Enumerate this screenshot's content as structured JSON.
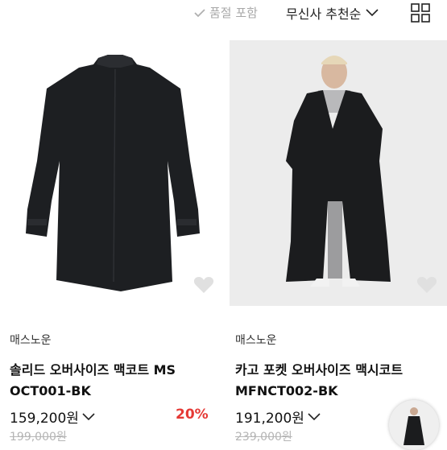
{
  "topbar": {
    "soldout_label": "품절 포함",
    "sort_label": "무신사 추천순"
  },
  "products": [
    {
      "brand": "매스노운",
      "name_line1": "솔리드 오버사이즈 맥코트 MS",
      "name_line2": "OCT001-BK",
      "price": "159,200원",
      "discount": "20%",
      "original_price": "199,000원"
    },
    {
      "brand": "매스노운",
      "name_line1": "카고 포켓 오버사이즈 맥시코트",
      "name_line2": "MFNCT002-BK",
      "price": "191,200원",
      "original_price": "239,000원"
    }
  ],
  "colors": {
    "discount": "#e53935",
    "muted": "#b5b5b5"
  }
}
